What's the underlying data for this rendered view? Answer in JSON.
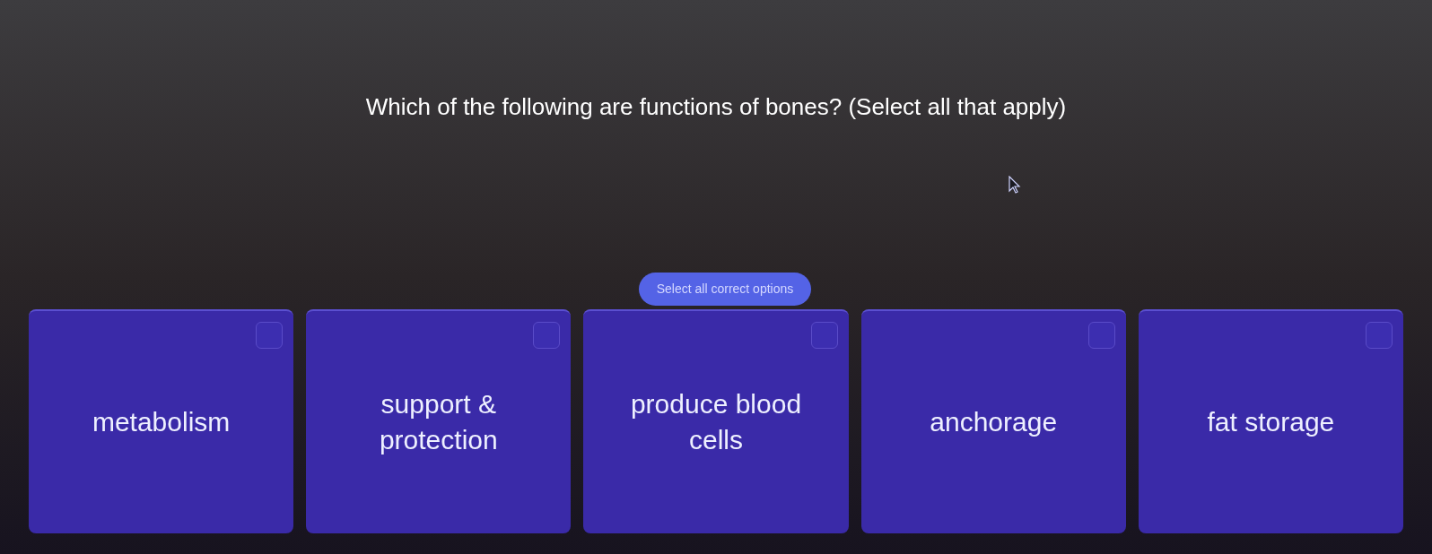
{
  "question": {
    "text": "Which of the following are functions of bones? (Select all that apply)"
  },
  "hint": {
    "text": "Select all correct options"
  },
  "options": [
    {
      "label": "metabolism",
      "checked": false
    },
    {
      "label": "support & protection",
      "checked": false
    },
    {
      "label": "produce blood cells",
      "checked": false
    },
    {
      "label": "anchorage",
      "checked": false
    },
    {
      "label": "fat storage",
      "checked": false
    }
  ]
}
